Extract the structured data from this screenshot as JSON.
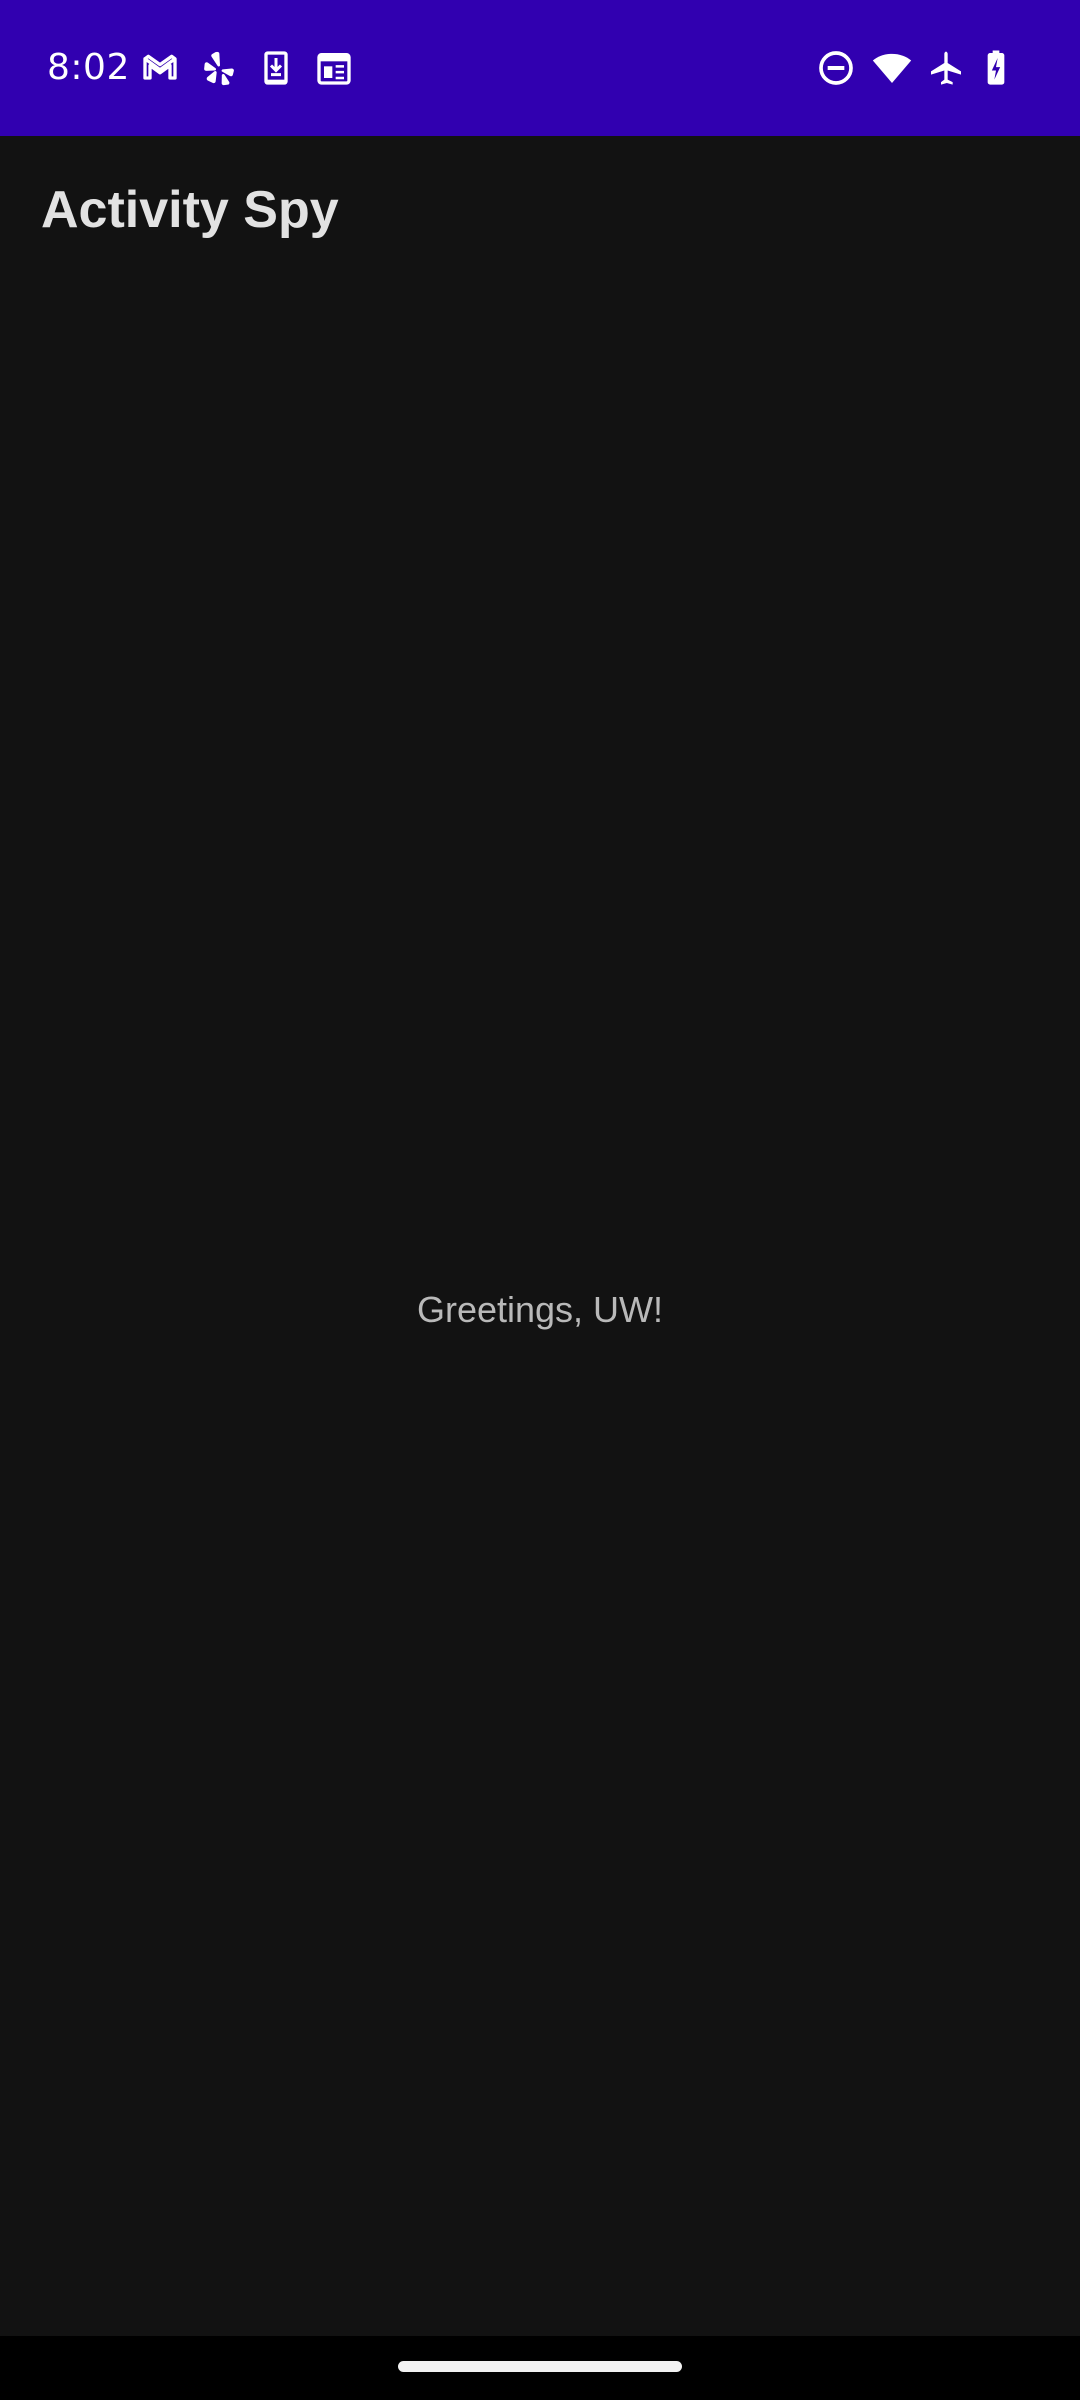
{
  "status_bar": {
    "time": "8:02",
    "background_color": "#3100B0",
    "left_icons": [
      "gmail-icon",
      "yelp-icon",
      "download-app-icon",
      "calendar-icon"
    ],
    "right_icons": [
      "do-not-disturb-icon",
      "wifi-icon",
      "airplane-mode-icon",
      "battery-charging-icon"
    ]
  },
  "app": {
    "title": "Activity Spy"
  },
  "main": {
    "greeting": "Greetings, UW!"
  },
  "theme": {
    "background": "#121212",
    "title_color": "#E2E2E2",
    "text_color": "#B9B9B9"
  }
}
